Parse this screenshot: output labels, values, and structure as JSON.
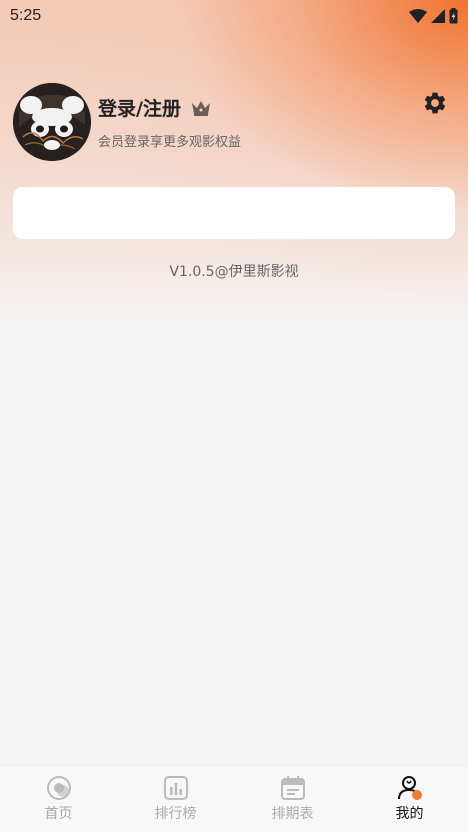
{
  "status_bar": {
    "time": "5:25"
  },
  "profile": {
    "title": "登录/注册",
    "subtitle": "会员登录享更多观影权益"
  },
  "footer": {
    "version": "V1.0.5@伊里斯影视"
  },
  "bottom_nav": [
    {
      "label": "首页",
      "icon": "home-icon",
      "active": false
    },
    {
      "label": "排行榜",
      "icon": "chart-icon",
      "active": false
    },
    {
      "label": "排期表",
      "icon": "calendar-icon",
      "active": false
    },
    {
      "label": "我的",
      "icon": "profile-icon",
      "active": true
    }
  ],
  "colors": {
    "accent": "#f0782e",
    "active_label": "#111111",
    "inactive_label": "#aaaaaa"
  }
}
